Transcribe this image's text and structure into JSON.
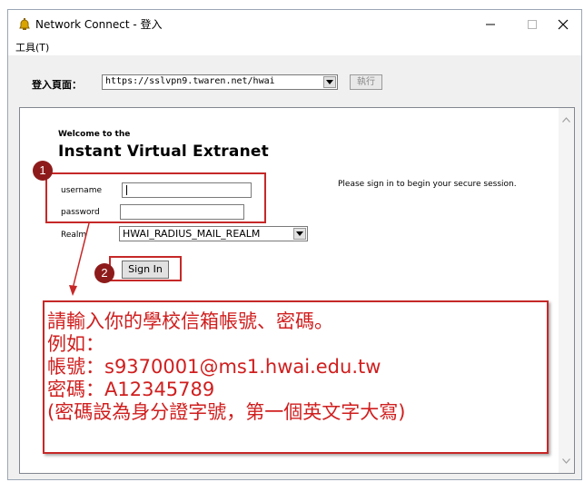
{
  "window": {
    "title": "Network Connect - 登入",
    "menu": {
      "tools": "工具(T)"
    }
  },
  "url_bar": {
    "label": "登入頁面：",
    "value": "https://sslvpn9.twaren.net/hwai",
    "go_label": "執行"
  },
  "login": {
    "welcome": "Welcome to the",
    "brand": "Instant Virtual Extranet",
    "username_label": "username",
    "password_label": "password",
    "realm_label": "Realm",
    "realm_value": "HWAI_RADIUS_MAIL_REALM",
    "signin_label": "Sign In",
    "side_message": "Please sign in to begin your secure session."
  },
  "annotations": {
    "badge1": "1",
    "badge2": "2",
    "lines": [
      "請輸入你的學校信箱帳號、密碼。",
      "例如：",
      "帳號：s9370001@ms1.hwai.edu.tw",
      "密碼：A12345789",
      "(密碼設為身分證字號，第一個英文字大寫)"
    ]
  },
  "colors": {
    "annotation": "#d01e1e",
    "badge": "#8e1b1b"
  },
  "icons": {
    "app": "vpn-bell-icon",
    "minimize": "minimize-icon",
    "maximize": "maximize-icon",
    "close": "close-icon"
  }
}
